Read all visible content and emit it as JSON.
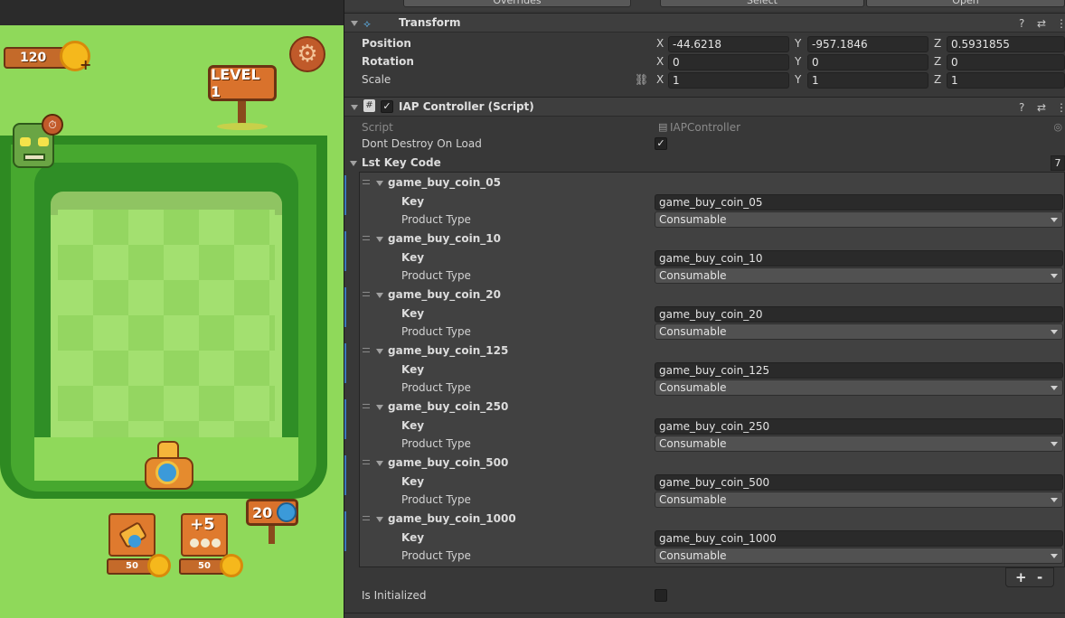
{
  "game": {
    "coins": "120",
    "level_sign": "LEVEL 1",
    "ammo_count": "20",
    "shop": [
      {
        "price": "50",
        "label": ""
      },
      {
        "price": "50",
        "label": "+5"
      }
    ]
  },
  "inspector": {
    "top_buttons": [
      "Overrides",
      "Select",
      "Open"
    ],
    "transform": {
      "title": "Transform",
      "rows": [
        {
          "label": "Position",
          "x": "-44.6218",
          "y": "-957.1846",
          "z": "0.5931855"
        },
        {
          "label": "Rotation",
          "x": "0",
          "y": "0",
          "z": "0"
        },
        {
          "label": "Scale",
          "x": "1",
          "y": "1",
          "z": "1"
        }
      ],
      "axis_labels": [
        "X",
        "Y",
        "Z"
      ]
    },
    "iap": {
      "title": "IAP Controller (Script)",
      "script_label": "Script",
      "script_value": "IAPController",
      "dont_destroy_label": "Dont Destroy On Load",
      "list_label": "Lst Key Code",
      "list_count": "7",
      "key_label": "Key",
      "product_type_label": "Product Type",
      "items": [
        {
          "name": "game_buy_coin_05",
          "key": "game_buy_coin_05",
          "type": "Consumable"
        },
        {
          "name": "game_buy_coin_10",
          "key": "game_buy_coin_10",
          "type": "Consumable"
        },
        {
          "name": "game_buy_coin_20",
          "key": "game_buy_coin_20",
          "type": "Consumable"
        },
        {
          "name": "game_buy_coin_125",
          "key": "game_buy_coin_125",
          "type": "Consumable"
        },
        {
          "name": "game_buy_coin_250",
          "key": "game_buy_coin_250",
          "type": "Consumable"
        },
        {
          "name": "game_buy_coin_500",
          "key": "game_buy_coin_500",
          "type": "Consumable"
        },
        {
          "name": "game_buy_coin_1000",
          "key": "game_buy_coin_1000",
          "type": "Consumable"
        }
      ],
      "add_label": "+",
      "remove_label": "-",
      "initialized_label": "Is Initialized"
    }
  }
}
